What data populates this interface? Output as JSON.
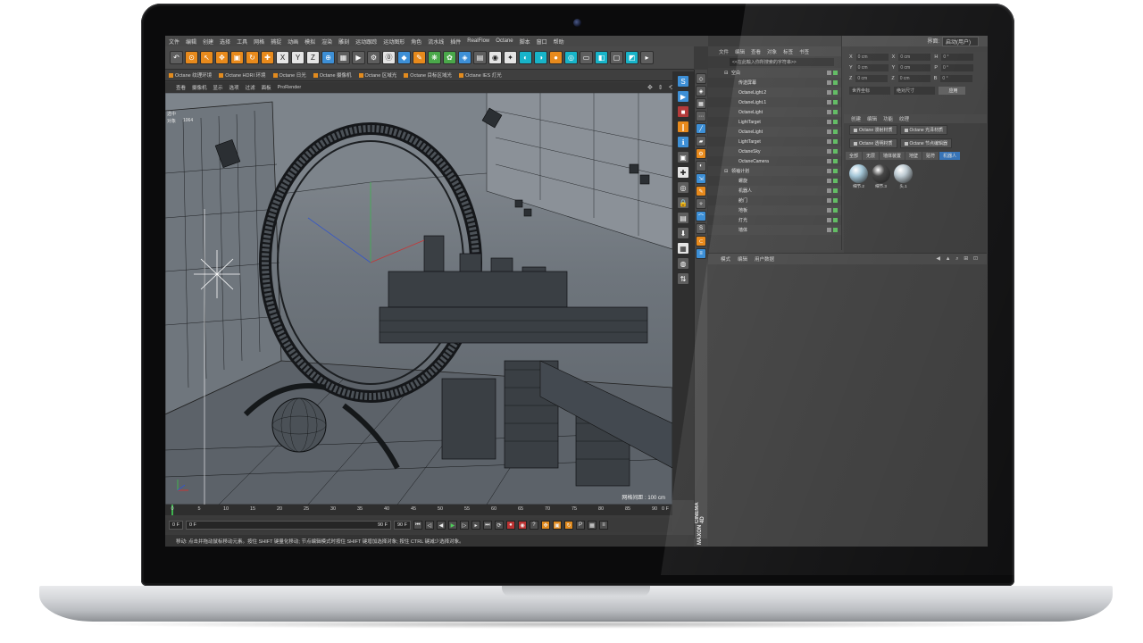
{
  "menubar": {
    "items": [
      "文件",
      "编辑",
      "创建",
      "选择",
      "工具",
      "网格",
      "捕捉",
      "动画",
      "模拟",
      "渲染",
      "雕刻",
      "运动跟踪",
      "运动图形",
      "角色",
      "流水线",
      "插件",
      "RealFlow",
      "Octane",
      "脚本",
      "窗口",
      "帮助"
    ],
    "layout_label": "界面:",
    "layout_value": "启动(用户)"
  },
  "octane_bar": {
    "items": [
      "Octane 纹理环境",
      "Octane HDRI 环境",
      "Octane 日光",
      "Octane 摄像机",
      "Octane 区域光",
      "Octane 目标区域光",
      "Octane IES 灯光"
    ]
  },
  "view_menu": {
    "items": [
      "查看",
      "摄像机",
      "显示",
      "选项",
      "过滤",
      "面板",
      "ProRender"
    ]
  },
  "viewport": {
    "hud": [
      {
        "k": "选中",
        "v": ""
      },
      {
        "k": "对象",
        "v": "1064"
      }
    ],
    "grid_label": "网格间距 : 100 cm"
  },
  "timeline": {
    "ticks": [
      "0",
      "5",
      "10",
      "15",
      "20",
      "25",
      "30",
      "35",
      "40",
      "45",
      "50",
      "55",
      "60",
      "65",
      "70",
      "75",
      "80",
      "85",
      "90"
    ],
    "end_label": "0 F"
  },
  "playbar": {
    "start": "0 F",
    "min": "0 F",
    "max": "90 F",
    "end": "90 F"
  },
  "status": {
    "text": "移动: 点击并拖动鼠标移动元素。按住 SHIFT 键量化移动; 节点编辑模式时按住 SHIFT 键增加选择对象; 按住 CTRL 键减少选择对象。"
  },
  "brand": {
    "line1": "MAXON",
    "line2": "CINEMA 4D"
  },
  "object_manager": {
    "menu": [
      "文件",
      "编辑",
      "查看",
      "对象",
      "标签",
      "书签"
    ],
    "search": "<<在此輸入你所搜索的字符串>>",
    "rows": [
      {
        "name": "空白",
        "depth": 0
      },
      {
        "name": "传送屏幕",
        "depth": 1
      },
      {
        "name": "OctaneLight.2",
        "depth": 1
      },
      {
        "name": "OctaneLight.1",
        "depth": 1
      },
      {
        "name": "OctaneLight",
        "depth": 1
      },
      {
        "name": "LightTarget",
        "depth": 1
      },
      {
        "name": "OctaneLight",
        "depth": 1
      },
      {
        "name": "LightTarget",
        "depth": 1
      },
      {
        "name": "OctaneSky",
        "depth": 1
      },
      {
        "name": "OctaneCamera",
        "depth": 1
      },
      {
        "name": "领袖计划",
        "depth": 0
      },
      {
        "name": "螺旋",
        "depth": 1
      },
      {
        "name": "机器人",
        "depth": 1
      },
      {
        "name": "舱门",
        "depth": 1
      },
      {
        "name": "地板",
        "depth": 1
      },
      {
        "name": "灯光",
        "depth": 1
      },
      {
        "name": "墙体",
        "depth": 1
      }
    ]
  },
  "attributes": {
    "menu": [
      "模式",
      "编辑",
      "用户数据"
    ]
  },
  "coordinates": {
    "rows": [
      {
        "axis": "X",
        "pos": "0 cm",
        "axis2": "X",
        "size": "0 cm",
        "axis3": "H",
        "rot": "0 °"
      },
      {
        "axis": "Y",
        "pos": "0 cm",
        "axis2": "Y",
        "size": "0 cm",
        "axis3": "P",
        "rot": "0 °"
      },
      {
        "axis": "Z",
        "pos": "0 cm",
        "axis2": "Z",
        "size": "0 cm",
        "axis3": "B",
        "rot": "0 °"
      }
    ],
    "mode": "世界坐标",
    "scale_mode": "绝对尺寸",
    "apply": "应用"
  },
  "materials": {
    "menu": [
      "创建",
      "编辑",
      "功能",
      "纹理"
    ],
    "buttons": [
      "Octane 漫射材质",
      "Octane 光泽材质",
      "Octane 透明材质",
      "Octane 节点编辑器"
    ],
    "tabs": [
      "全部",
      "无层",
      "墙体装置",
      "地壁",
      "贴符",
      "机器人"
    ],
    "active_tab": 5,
    "swatches": [
      {
        "name": "细节.2",
        "color": "#9fc4d6"
      },
      {
        "name": "细节.3",
        "color": "#3a3a3a"
      },
      {
        "name": "头.1",
        "color": "#b9c7cf"
      }
    ]
  }
}
